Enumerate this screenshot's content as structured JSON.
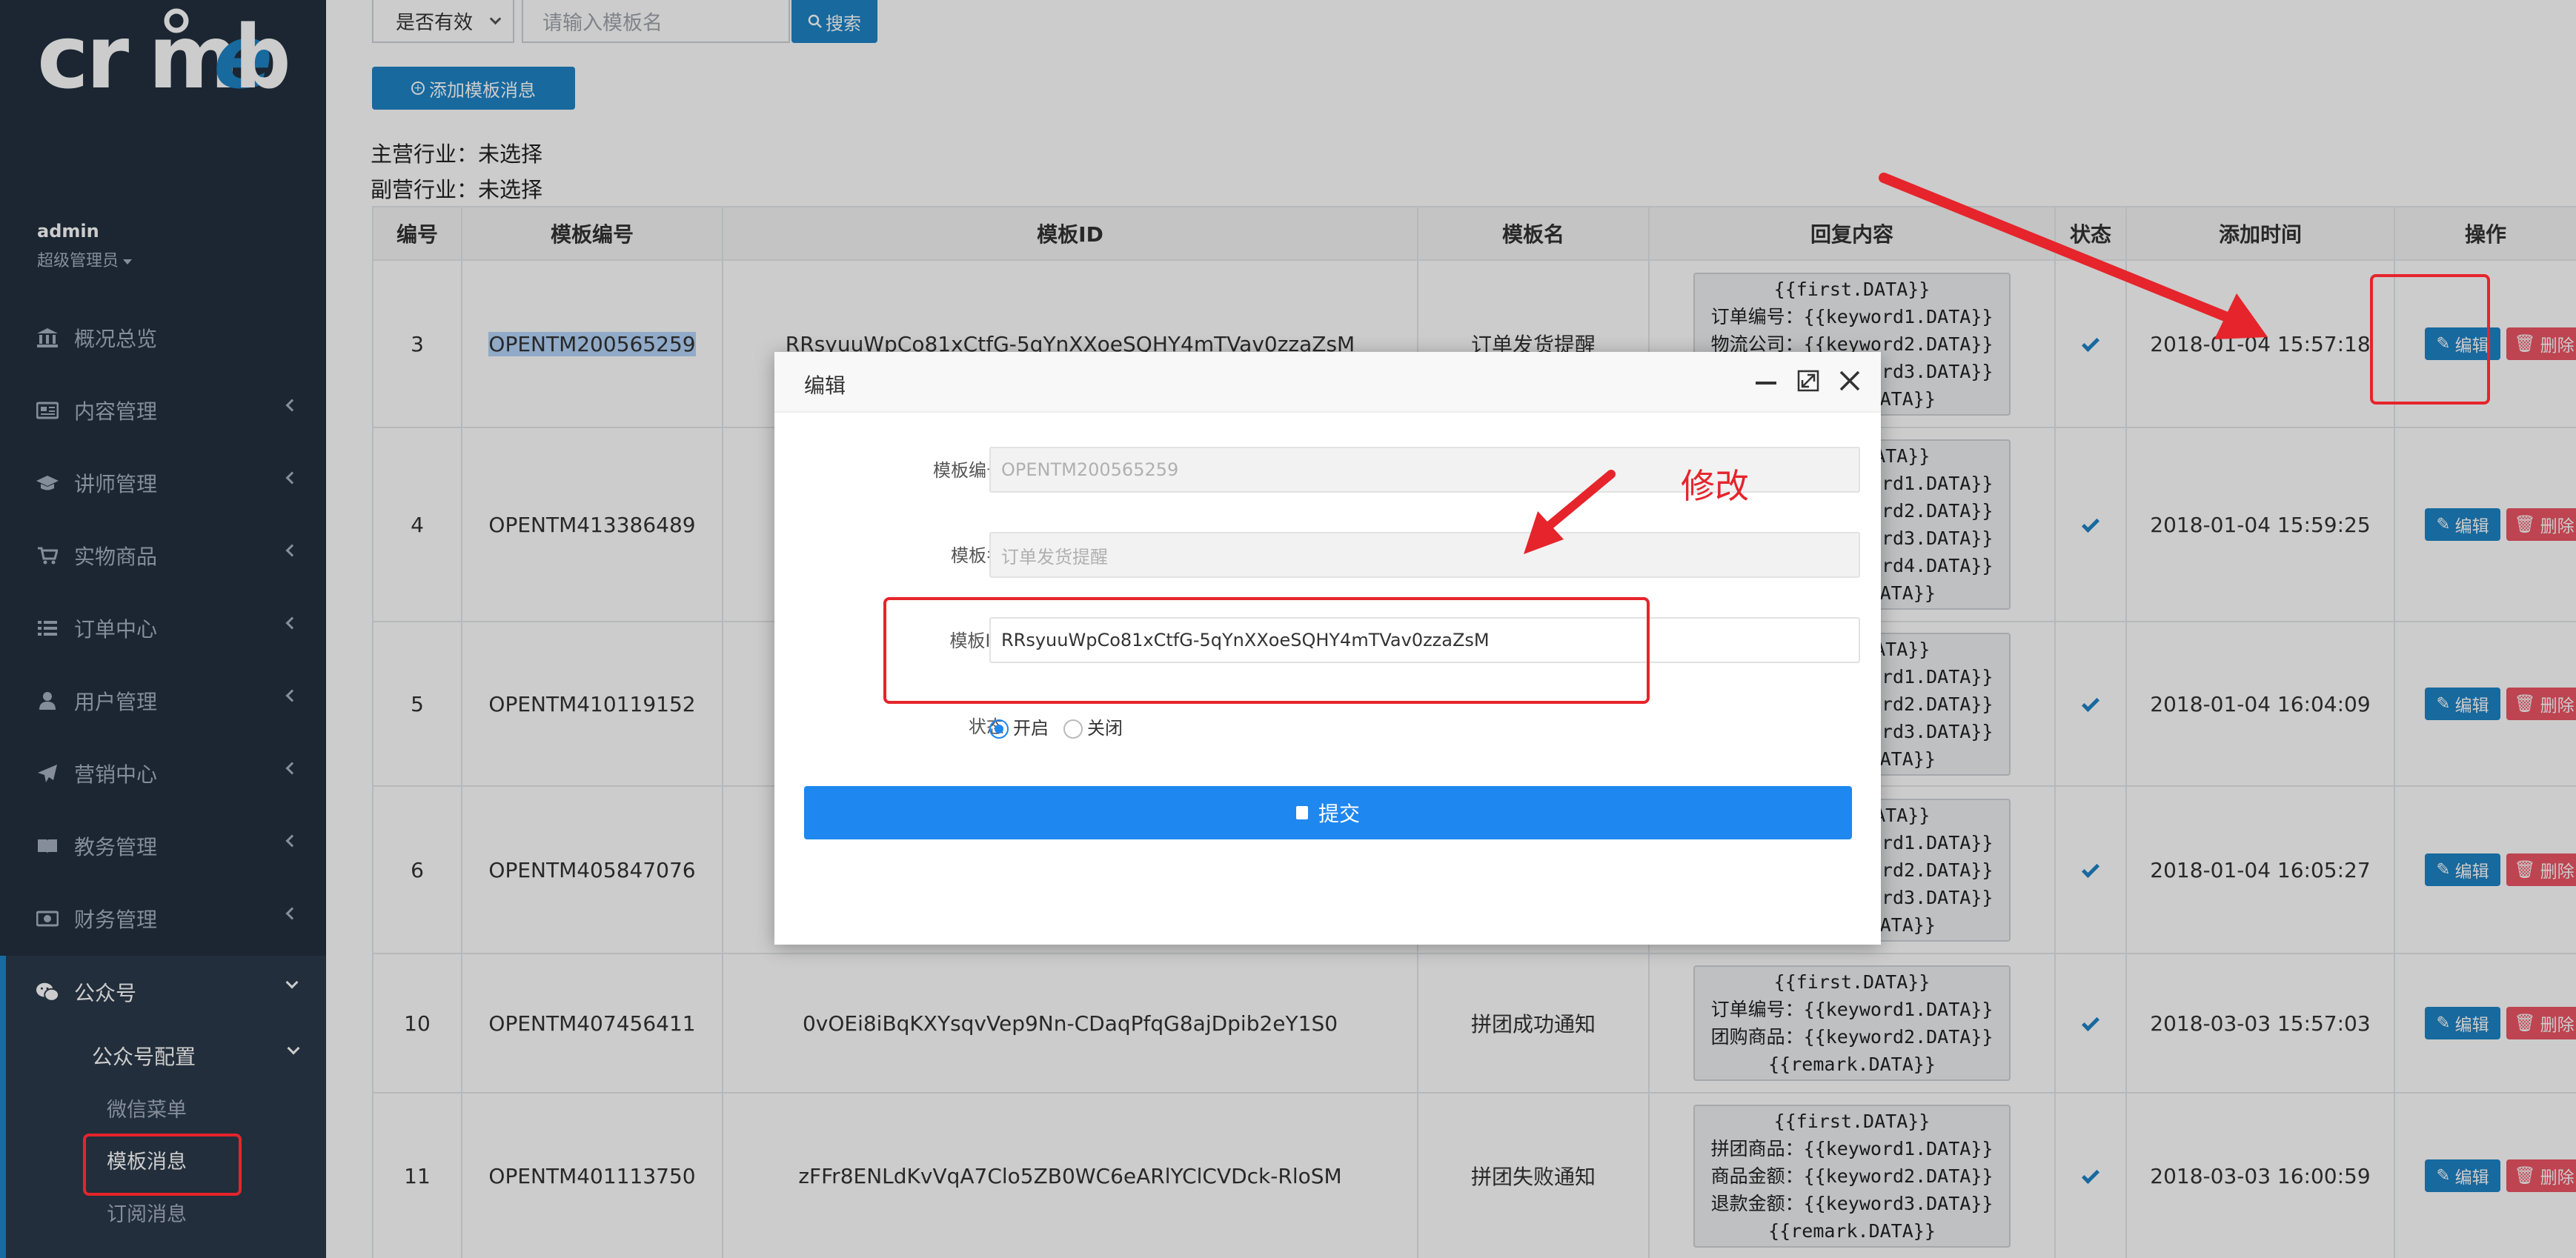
{
  "logo_text": "crmeb",
  "user": {
    "name": "admin",
    "role": "超级管理员"
  },
  "sidebar": {
    "items": [
      {
        "label": "概况总览",
        "icon": "bank-icon",
        "has_chevron": false
      },
      {
        "label": "内容管理",
        "icon": "newspaper-icon",
        "has_chevron": true
      },
      {
        "label": "讲师管理",
        "icon": "graduation-cap-icon",
        "has_chevron": true
      },
      {
        "label": "实物商品",
        "icon": "cart-icon",
        "has_chevron": true
      },
      {
        "label": "订单中心",
        "icon": "list-icon",
        "has_chevron": true
      },
      {
        "label": "用户管理",
        "icon": "user-icon",
        "has_chevron": true
      },
      {
        "label": "营销中心",
        "icon": "paper-plane-icon",
        "has_chevron": true
      },
      {
        "label": "教务管理",
        "icon": "book-icon",
        "has_chevron": true
      },
      {
        "label": "财务管理",
        "icon": "money-icon",
        "has_chevron": true
      }
    ],
    "active_section": {
      "label": "公众号",
      "icon": "wechat-icon"
    },
    "submenu_title": "公众号配置",
    "submenu_items": [
      "微信菜单",
      "模板消息",
      "订阅消息"
    ],
    "active_submenu": "模板消息"
  },
  "filters": {
    "status_selected": "是否有效",
    "search_placeholder": "请输入模板名",
    "search_button": "搜索",
    "add_button": "添加模板消息"
  },
  "industry": {
    "main": "主营行业：未选择",
    "sub": "副营行业：未选择"
  },
  "table": {
    "headers": [
      "编号",
      "模板编号",
      "模板ID",
      "模板名",
      "回复内容",
      "状态",
      "添加时间",
      "操作"
    ],
    "rows": [
      {
        "id": "3",
        "code": "OPENTM200565259",
        "template_id": "RRsyuuWpCo81xCtfG-5qYnXXoeSQHY4mTVav0zzaZsM",
        "name": "订单发货提醒",
        "reply": "{{first.DATA}}\n订单编号：{{keyword1.DATA}}\n物流公司：{{keyword2.DATA}}\n物流单号：{{keyword3.DATA}}\n{{remark.DATA}}",
        "status": true,
        "time": "2018-01-04 15:57:18"
      },
      {
        "id": "4",
        "code": "OPENTM413386489",
        "template_id": "",
        "name": "",
        "reply": "{{first.DATA}}\n订单编号：{{keyword1.DATA}}\n商品名称：{{keyword2.DATA}}\n订单金额：{{keyword3.DATA}}\n支付时间：{{keyword4.DATA}}\n{{remark.DATA}}",
        "status": true,
        "time": "2018-01-04 15:59:25"
      },
      {
        "id": "5",
        "code": "OPENTM410119152",
        "template_id": "",
        "name": "",
        "reply": "{{first.DATA}}\n订单编号：{{keyword1.DATA}}\n商品名称：{{keyword2.DATA}}\n支付金额：{{keyword3.DATA}}\n{{remark.DATA}}",
        "status": true,
        "time": "2018-01-04 16:04:09"
      },
      {
        "id": "6",
        "code": "OPENTM405847076",
        "template_id": "",
        "name": "",
        "reply": "{{first.DATA}}\n订单编号：{{keyword1.DATA}}\n商品名称：{{keyword2.DATA}}\n退款金额：{{keyword3.DATA}}\n{{remark.DATA}}",
        "status": true,
        "time": "2018-01-04 16:05:27"
      },
      {
        "id": "10",
        "code": "OPENTM407456411",
        "template_id": "0vOEi8iBqKXYsqvVep9Nn-CDaqPfqG8ajDpib2eY1S0",
        "name": "拼团成功通知",
        "reply": "{{first.DATA}}\n订单编号：{{keyword1.DATA}}\n团购商品：{{keyword2.DATA}}\n{{remark.DATA}}",
        "status": true,
        "time": "2018-03-03 15:57:03"
      },
      {
        "id": "11",
        "code": "OPENTM401113750",
        "template_id": "zFFr8ENLdKvVqA7Clo5ZB0WC6eARlYClCVDck-RloSM",
        "name": "拼团失败通知",
        "reply": "{{first.DATA}}\n拼团商品：{{keyword1.DATA}}\n商品金额：{{keyword2.DATA}}\n退款金额：{{keyword3.DATA}}\n{{remark.DATA}}",
        "status": true,
        "time": "2018-03-03 16:00:59"
      }
    ],
    "edit_label": "编辑",
    "delete_label": "删除"
  },
  "modal": {
    "title": "编辑",
    "fields": {
      "code_label": "模板编号",
      "code_value": "OPENTM200565259",
      "name_label": "模板名",
      "name_value": "订单发货提醒",
      "id_label": "模板ID",
      "id_value": "RRsyuuWpCo81xCtfG-5qYnXXoeSQHY4mTVav0zzaZsM",
      "status_label": "状态",
      "status_on": "开启",
      "status_off": "关闭",
      "status_selected": "开启"
    },
    "submit_label": "提交"
  },
  "annotation": {
    "text": "修改",
    "color": "#e6242b"
  },
  "colors": {
    "sidebar_bg": "#22303f",
    "primary": "#1d84c6",
    "danger": "#ed5565",
    "modal_primary": "#1e87f0"
  }
}
